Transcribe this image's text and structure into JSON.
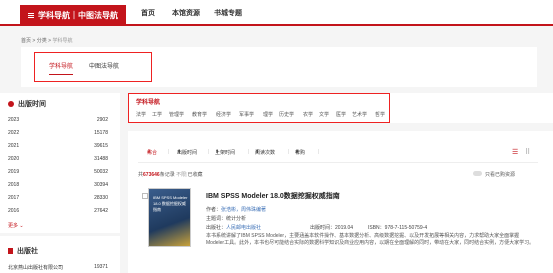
{
  "header": {
    "brand": "学科导航｜中图法导航",
    "nav": [
      "首页",
      "本馆资源",
      "书城专题"
    ]
  },
  "breadcrumb": {
    "home": "首页",
    "sep": " > ",
    "category": "分类",
    "current": "学科导航"
  },
  "tabs": [
    "学科导航",
    "中图法导航"
  ],
  "filters": {
    "year_title": "出版时间",
    "years": [
      {
        "year": "2023",
        "count": "2902"
      },
      {
        "year": "2022",
        "count": "15178"
      },
      {
        "year": "2021",
        "count": "39615"
      },
      {
        "year": "2020",
        "count": "31488"
      },
      {
        "year": "2019",
        "count": "50032"
      },
      {
        "year": "2018",
        "count": "30394"
      },
      {
        "year": "2017",
        "count": "28330"
      },
      {
        "year": "2016",
        "count": "27642"
      }
    ],
    "more": "更多",
    "publisher_title": "出版社",
    "publishers": [
      {
        "name": "北京燕山出版社有限公司",
        "count": "19371"
      }
    ]
  },
  "subjects": {
    "title": "学科导航",
    "items": [
      "法学",
      "工学",
      "管理学",
      "教育学",
      "经济学",
      "军事学",
      "理学",
      "历史学",
      "农学",
      "文学",
      "医学",
      "艺术学",
      "哲学"
    ]
  },
  "sort": {
    "items": [
      "综合",
      "出版时间",
      "上架时间",
      "阅读次数",
      "荐购"
    ],
    "arrows": [
      "⬇",
      "⬍",
      "⬍",
      "⬍",
      "⬍"
    ]
  },
  "results": {
    "prefix": "共",
    "count": "673646",
    "suffix": "条记录",
    "unlimited": "不限",
    "collected": "已收藏",
    "toggle_label": "只看已购资源"
  },
  "book": {
    "cover_text": "IBM SPSS Modeler 18.0 数据挖掘权威指南",
    "title": "IBM SPSS Modeler 18.0数据挖掘权威指南",
    "author_label": "作者：",
    "author": "张浩彬，周伟珠编著",
    "subject_label": "主题词：",
    "subject": "统计分析",
    "publisher_label": "出版社：",
    "publisher": "人民邮电出版社",
    "date_label": "出版时间：",
    "date": "2019.04",
    "isbn_label": "ISBN：",
    "isbn": "978-7-115-50759-4",
    "desc": "本书系统讲解了IBM SPSS Modeler，主要涵盖本软件操作、基本数据分析、高级数据挖掘、以及开发拓展等相关内容，力求帮助大家全面掌握Modeler工具。此外，本书也尽可能结合实际的数据科学知识及商业应用内容，以期在全面理解的同时，带动在大家，同时结合实例，方便大家学习。"
  },
  "colors": {
    "accent": "#c3141b",
    "highlight_box": "#ee2222",
    "link": "#3b6fb6"
  },
  "icons": [
    "menu-icon",
    "list-view-icon",
    "grid-view-icon",
    "sort-arrow-icon"
  ]
}
